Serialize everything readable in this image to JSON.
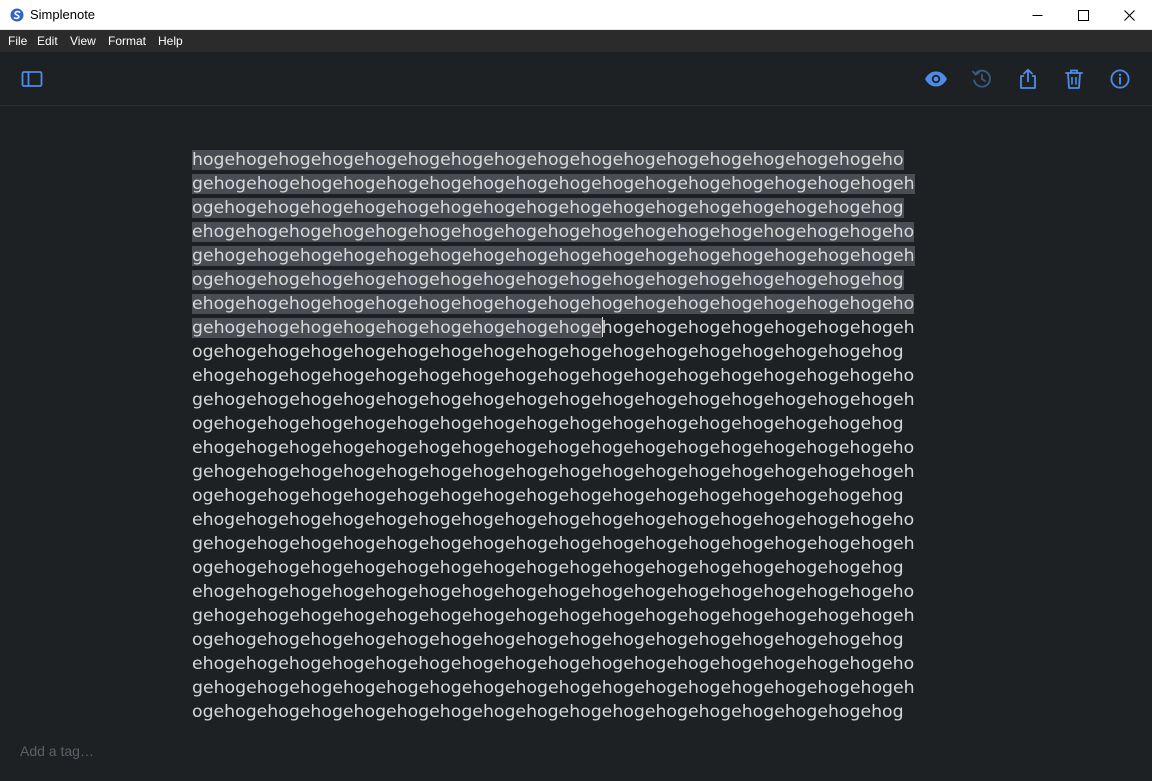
{
  "app": {
    "title": "Simplenote",
    "accent": "#4f8ce8"
  },
  "window_controls": {
    "minimize": "minimize-icon",
    "maximize": "maximize-icon",
    "close": "close-icon"
  },
  "menu": {
    "items": [
      "File",
      "Edit",
      "View",
      "Format",
      "Help"
    ]
  },
  "toolbar": {
    "sidebar_toggle": "sidebar-toggle-icon",
    "preview": "eye-icon",
    "history": "history-icon",
    "share": "share-icon",
    "trash": "trash-icon",
    "info": "info-icon"
  },
  "editor": {
    "selection_color": "#4a4e54",
    "text_color": "#d8d8d8",
    "lines": [
      {
        "sel": "hogehogehogehogehogehogehogehogehogehogehogehogehogehogehogehogeho",
        "rest": ""
      },
      {
        "sel": "gehogehogehogehogehogehogehogehogehogehogehogehogehogehogehogehogeh",
        "rest": ""
      },
      {
        "sel": "ogehogehogehogehogehogehogehogehogehogehogehogehogehogehogehogehog",
        "rest": ""
      },
      {
        "sel": "ehogehogehogehogehogehogehogehogehogehogehogehogehogehogehogehogeho",
        "rest": ""
      },
      {
        "sel": "gehogehogehogehogehogehogehogehogehogehogehogehogehogehogehogehogeh",
        "rest": ""
      },
      {
        "sel": "ogehogehogehogehogehogehogehogehogehogehogehogehogehogehogehogehog",
        "rest": ""
      },
      {
        "sel": "ehogehogehogehogehogehogehogehogehogehogehogehogehogehogehogehogeho",
        "rest": ""
      },
      {
        "sel": "gehogehogehogehogehogehogehogehogehoge",
        "rest": "hogehogehogehogehogehogehogeh"
      },
      {
        "sel": "",
        "rest": "ogehogehogehogehogehogehogehogehogehogehogehogehogehogehogehogehog"
      },
      {
        "sel": "",
        "rest": "ehogehogehogehogehogehogehogehogehogehogehogehogehogehogehogehogeho"
      },
      {
        "sel": "",
        "rest": "gehogehogehogehogehogehogehogehogehogehogehogehogehogehogehogehogeh"
      },
      {
        "sel": "",
        "rest": "ogehogehogehogehogehogehogehogehogehogehogehogehogehogehogehogehog"
      },
      {
        "sel": "",
        "rest": "ehogehogehogehogehogehogehogehogehogehogehogehogehogehogehogehogeho"
      },
      {
        "sel": "",
        "rest": "gehogehogehogehogehogehogehogehogehogehogehogehogehogehogehogehogeh"
      },
      {
        "sel": "",
        "rest": "ogehogehogehogehogehogehogehogehogehogehogehogehogehogehogehogehog"
      },
      {
        "sel": "",
        "rest": "ehogehogehogehogehogehogehogehogehogehogehogehogehogehogehogehogeho"
      },
      {
        "sel": "",
        "rest": "gehogehogehogehogehogehogehogehogehogehogehogehogehogehogehogehogeh"
      },
      {
        "sel": "",
        "rest": "ogehogehogehogehogehogehogehogehogehogehogehogehogehogehogehogehog"
      },
      {
        "sel": "",
        "rest": "ehogehogehogehogehogehogehogehogehogehogehogehogehogehogehogehogeho"
      },
      {
        "sel": "",
        "rest": "gehogehogehogehogehogehogehogehogehogehogehogehogehogehogehogehogeh"
      },
      {
        "sel": "",
        "rest": "ogehogehogehogehogehogehogehogehogehogehogehogehogehogehogehogehog"
      },
      {
        "sel": "",
        "rest": "ehogehogehogehogehogehogehogehogehogehogehogehogehogehogehogehogeho"
      },
      {
        "sel": "",
        "rest": "gehogehogehogehogehogehogehogehogehogehogehogehogehogehogehogehogeh"
      },
      {
        "sel": "",
        "rest": "ogehogehogehogehogehogehogehogehogehogehogehogehogehogehogehogehog"
      }
    ]
  },
  "tags": {
    "placeholder": "Add a tag…",
    "value": ""
  }
}
